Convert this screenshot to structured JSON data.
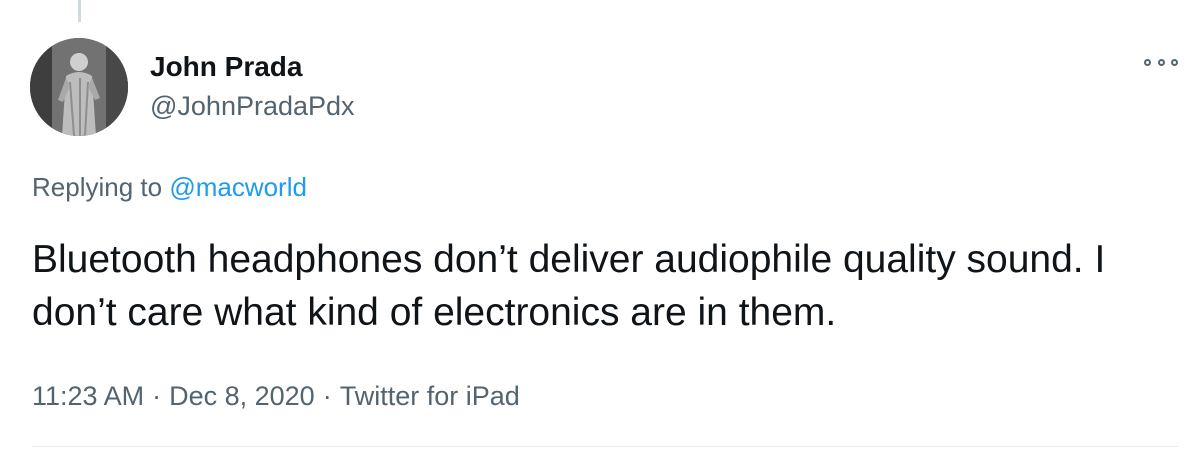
{
  "user": {
    "display_name": "John Prada",
    "handle": "@JohnPradaPdx"
  },
  "reply": {
    "prefix": "Replying to",
    "mention": "@macworld"
  },
  "tweet": {
    "text": "Bluetooth headphones don’t deliver audiophile quality sound. I don’t care what kind of electronics are in them.",
    "time": "11:23 AM",
    "date": "Dec 8, 2020",
    "source": "Twitter for iPad",
    "separator": "·"
  },
  "icons": {
    "more": "more-options-icon",
    "avatar": "statue-avatar"
  },
  "colors": {
    "text": "#0f1419",
    "secondary": "#536471",
    "link": "#1d9bf0",
    "divider": "#e6ecf0"
  }
}
